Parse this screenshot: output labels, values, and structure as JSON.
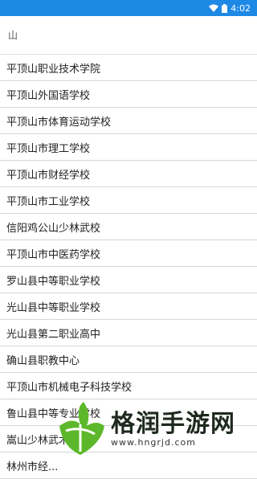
{
  "status": {
    "time": "4:02"
  },
  "search": {
    "value": "山"
  },
  "results": [
    "平顶山职业技术学院",
    "平顶山外国语学校",
    "平顶山市体育运动学校",
    "平顶山市理工学校",
    "平顶山市财经学校",
    "平顶山市工业学校",
    "信阳鸡公山少林武校",
    "平顶山市中医药学校",
    "罗山县中等职业学校",
    "光山县中等职业学校",
    "光山县第二职业高中",
    "确山县职教中心",
    "平顶山市机械电子科技学校",
    "鲁山县中等专业学校",
    "嵩山少林武术学校",
    "林州市经..."
  ],
  "watermark": {
    "title": "格润手游网",
    "url": "www.hngrjd.com"
  },
  "colors": {
    "status_bar": "#1e88e5",
    "watermark_logo": "#5cb82a"
  }
}
